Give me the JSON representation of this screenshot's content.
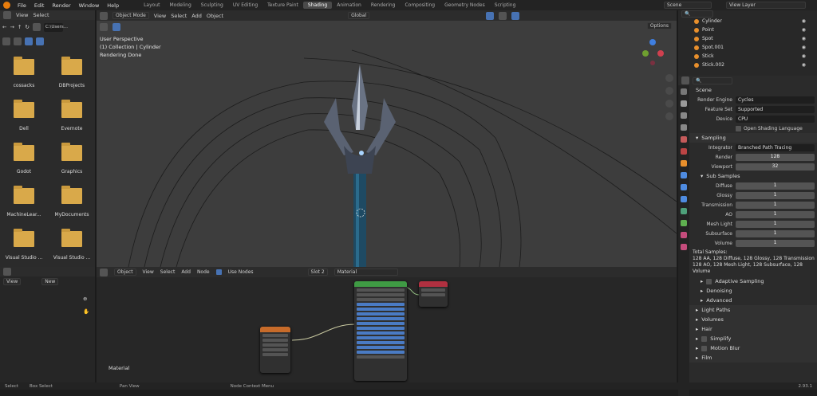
{
  "menu": [
    "File",
    "Edit",
    "Render",
    "Window",
    "Help"
  ],
  "workspaces": [
    "Layout",
    "Modeling",
    "Sculpting",
    "UV Editing",
    "Texture Paint",
    "Shading",
    "Animation",
    "Rendering",
    "Compositing",
    "Geometry Nodes",
    "Scripting"
  ],
  "active_workspace": "Shading",
  "scene": "Scene",
  "view_layer": "View Layer",
  "filebrowser": {
    "menus": [
      "View",
      "Select"
    ],
    "path": "C:\\Users...",
    "folders": [
      "cossacks",
      "DBProjects",
      "Dell",
      "Evernote",
      "Godot",
      "Graphics",
      "MachineLear...",
      "MyDocuments",
      "Visual Studio ...",
      "Visual Studio ..."
    ]
  },
  "viewport": {
    "mode": "Object Mode",
    "menus": [
      "View",
      "Select",
      "Add",
      "Object"
    ],
    "orientation": "Global",
    "options": "Options",
    "info": [
      "User Perspective",
      "(1) Collection | Cylinder",
      "Rendering Done"
    ]
  },
  "outliner": {
    "items": [
      "Cylinder",
      "Point",
      "Spot",
      "Spot.001",
      "Stick",
      "Stick.002"
    ]
  },
  "properties": {
    "scene": "Scene",
    "render_engine_label": "Render Engine",
    "render_engine": "Cycles",
    "feature_set_label": "Feature Set",
    "feature_set": "Supported",
    "device_label": "Device",
    "device": "CPU",
    "osl": "Open Shading Language",
    "sampling": "Sampling",
    "integrator_label": "Integrator",
    "integrator": "Branched Path Tracing",
    "render_label": "Render",
    "render": "128",
    "viewport_label": "Viewport",
    "viewport": "32",
    "sub_samples": "Sub Samples",
    "subs": [
      {
        "k": "Diffuse",
        "v": "1"
      },
      {
        "k": "Glossy",
        "v": "1"
      },
      {
        "k": "Transmission",
        "v": "1"
      },
      {
        "k": "AO",
        "v": "1"
      },
      {
        "k": "Mesh Light",
        "v": "1"
      },
      {
        "k": "Subsurface",
        "v": "1"
      },
      {
        "k": "Volume",
        "v": "1"
      }
    ],
    "total_label": "Total Samples:",
    "total_1": "128 AA, 128 Diffuse, 128 Glossy, 128 Transmission",
    "total_2": "128 AO, 128 Mesh Light, 128 Subsurface, 128 Volume",
    "adaptive": "Adaptive Sampling",
    "denoising": "Denoising",
    "advanced": "Advanced",
    "panels": [
      "Light Paths",
      "Volumes",
      "Hair",
      "Simplify",
      "Motion Blur",
      "Film"
    ]
  },
  "node_editor": {
    "type": "Object",
    "menus": [
      "View",
      "Select",
      "Add",
      "Node"
    ],
    "use_nodes": "Use Nodes",
    "slot": "Slot 2",
    "material": "Material",
    "label": "Material"
  },
  "left_panel": {
    "view": "View",
    "new": "New"
  },
  "status": {
    "select": "Select",
    "box_select": "Box Select",
    "pan_view": "Pan View",
    "node_context": "Node Context Menu",
    "version": "2.93.1"
  },
  "colors": {
    "accent": "#4772b3",
    "orange": "#e87d0d"
  }
}
